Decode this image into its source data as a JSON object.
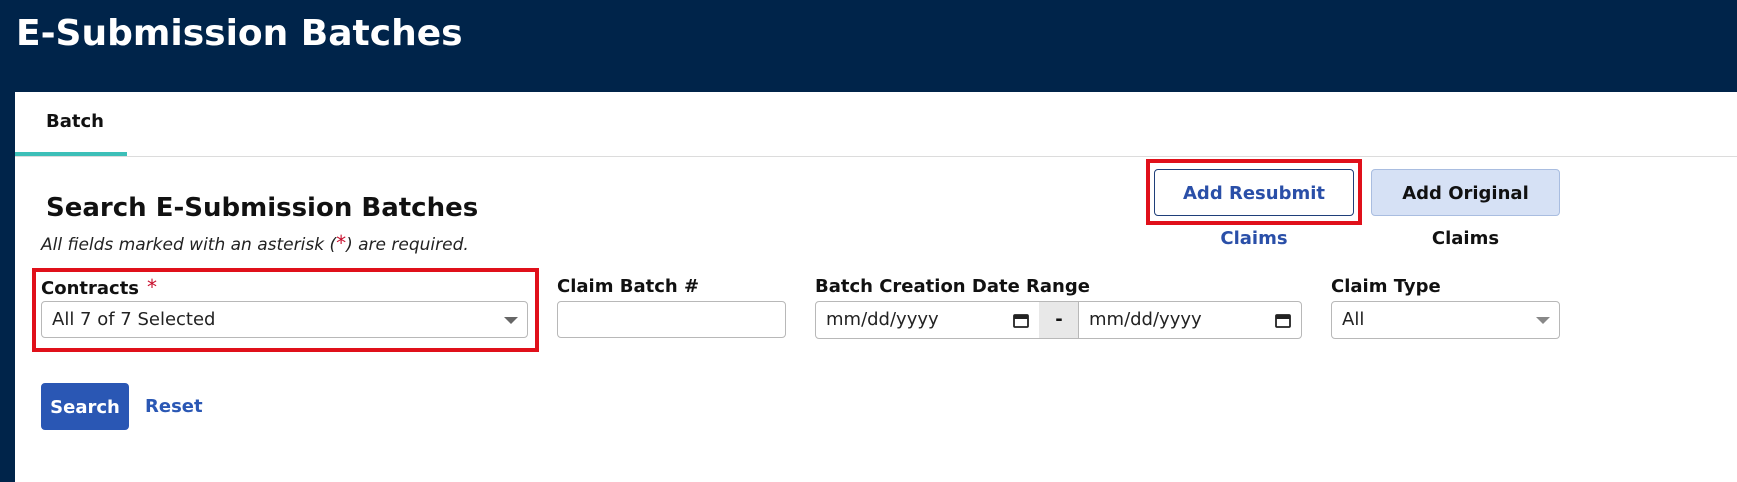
{
  "header": {
    "title": "E-Submission Batches"
  },
  "tabs": [
    {
      "label": "Batch",
      "active": true
    }
  ],
  "search": {
    "title": "Search E-Submission Batches",
    "required_note_prefix": "All fields marked with an asterisk (",
    "required_note_asterisk": "*",
    "required_note_suffix": ") are required.",
    "actions": {
      "add_resubmit_label": "Add Resubmit Claims",
      "add_original_label": "Add Original Claims"
    },
    "fields": {
      "contracts": {
        "label": "Contracts",
        "required_marker": "*",
        "value": "All 7 of 7 Selected"
      },
      "claim_batch": {
        "label": "Claim Batch #",
        "value": ""
      },
      "date_range": {
        "label": "Batch Creation Date Range",
        "start_placeholder": "mm/dd/yyyy",
        "separator": "-",
        "end_placeholder": "mm/dd/yyyy"
      },
      "claim_type": {
        "label": "Claim Type",
        "value": "All"
      }
    },
    "buttons": {
      "search_label": "Search",
      "reset_label": "Reset"
    }
  },
  "colors": {
    "header_bg": "#00244a",
    "tab_indicator": "#3cbfb8",
    "primary": "#2a57b4",
    "highlight": "#e0101a",
    "required": "#c8102e"
  },
  "icons": {
    "calendar": "calendar-icon",
    "dropdown": "chevron-down-icon"
  }
}
